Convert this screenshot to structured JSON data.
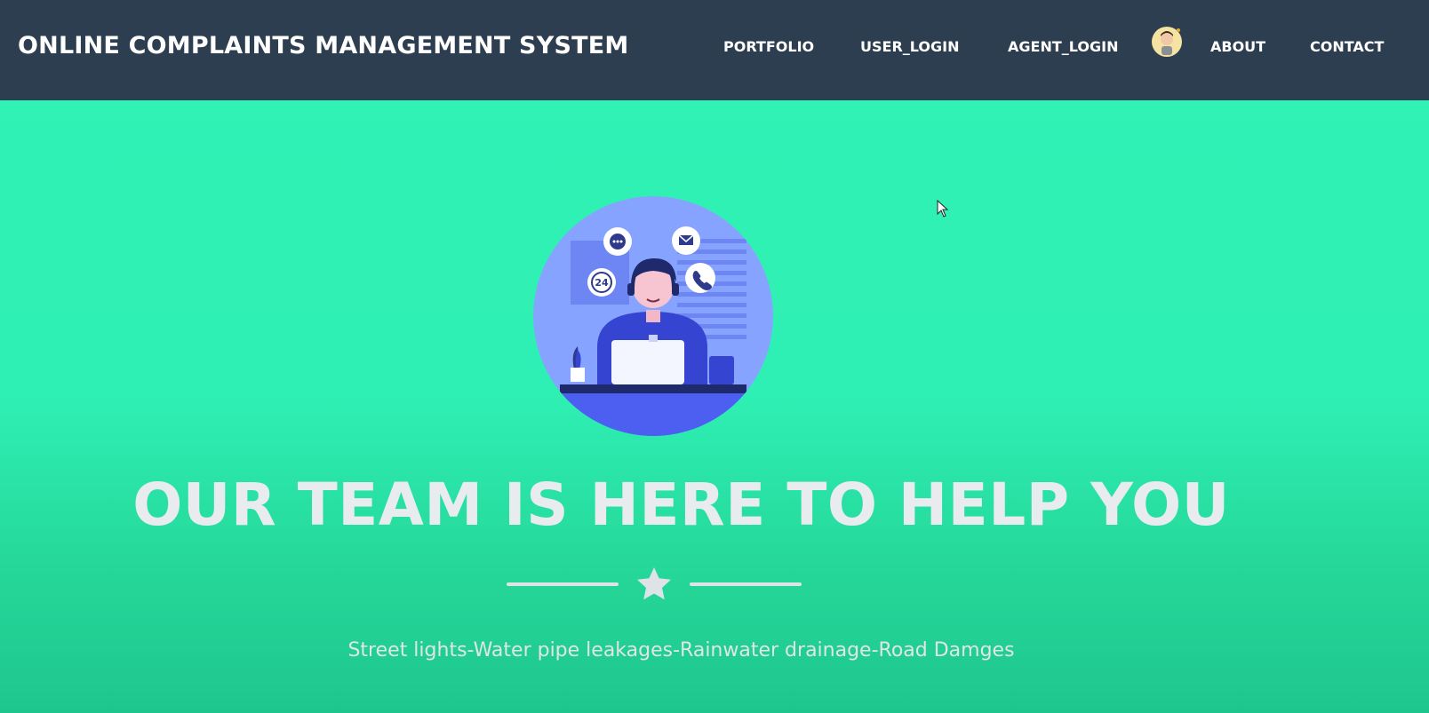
{
  "navbar": {
    "brand": "ONLINE COMPLAINTS MANAGEMENT SYSTEM",
    "links": [
      {
        "label": "PORTFOLIO"
      },
      {
        "label": "USER_LOGIN"
      },
      {
        "label": "AGENT_LOGIN"
      },
      {
        "label": "ABOUT"
      },
      {
        "label": "CONTACT"
      }
    ],
    "avatar_icon": "user-avatar-icon"
  },
  "hero": {
    "illustration_icon": "support-agent-icon",
    "title": "OUR TEAM IS HERE TO HELP YOU",
    "divider_icon": "star-icon",
    "subtitle": "Street lights-Water pipe leakages-Rainwater drainage-Road Damges",
    "badge_text": "24"
  },
  "colors": {
    "navbar_bg": "#2d3e50",
    "hero_bg": "#31f2b5",
    "title_text": "#e9ecef"
  }
}
